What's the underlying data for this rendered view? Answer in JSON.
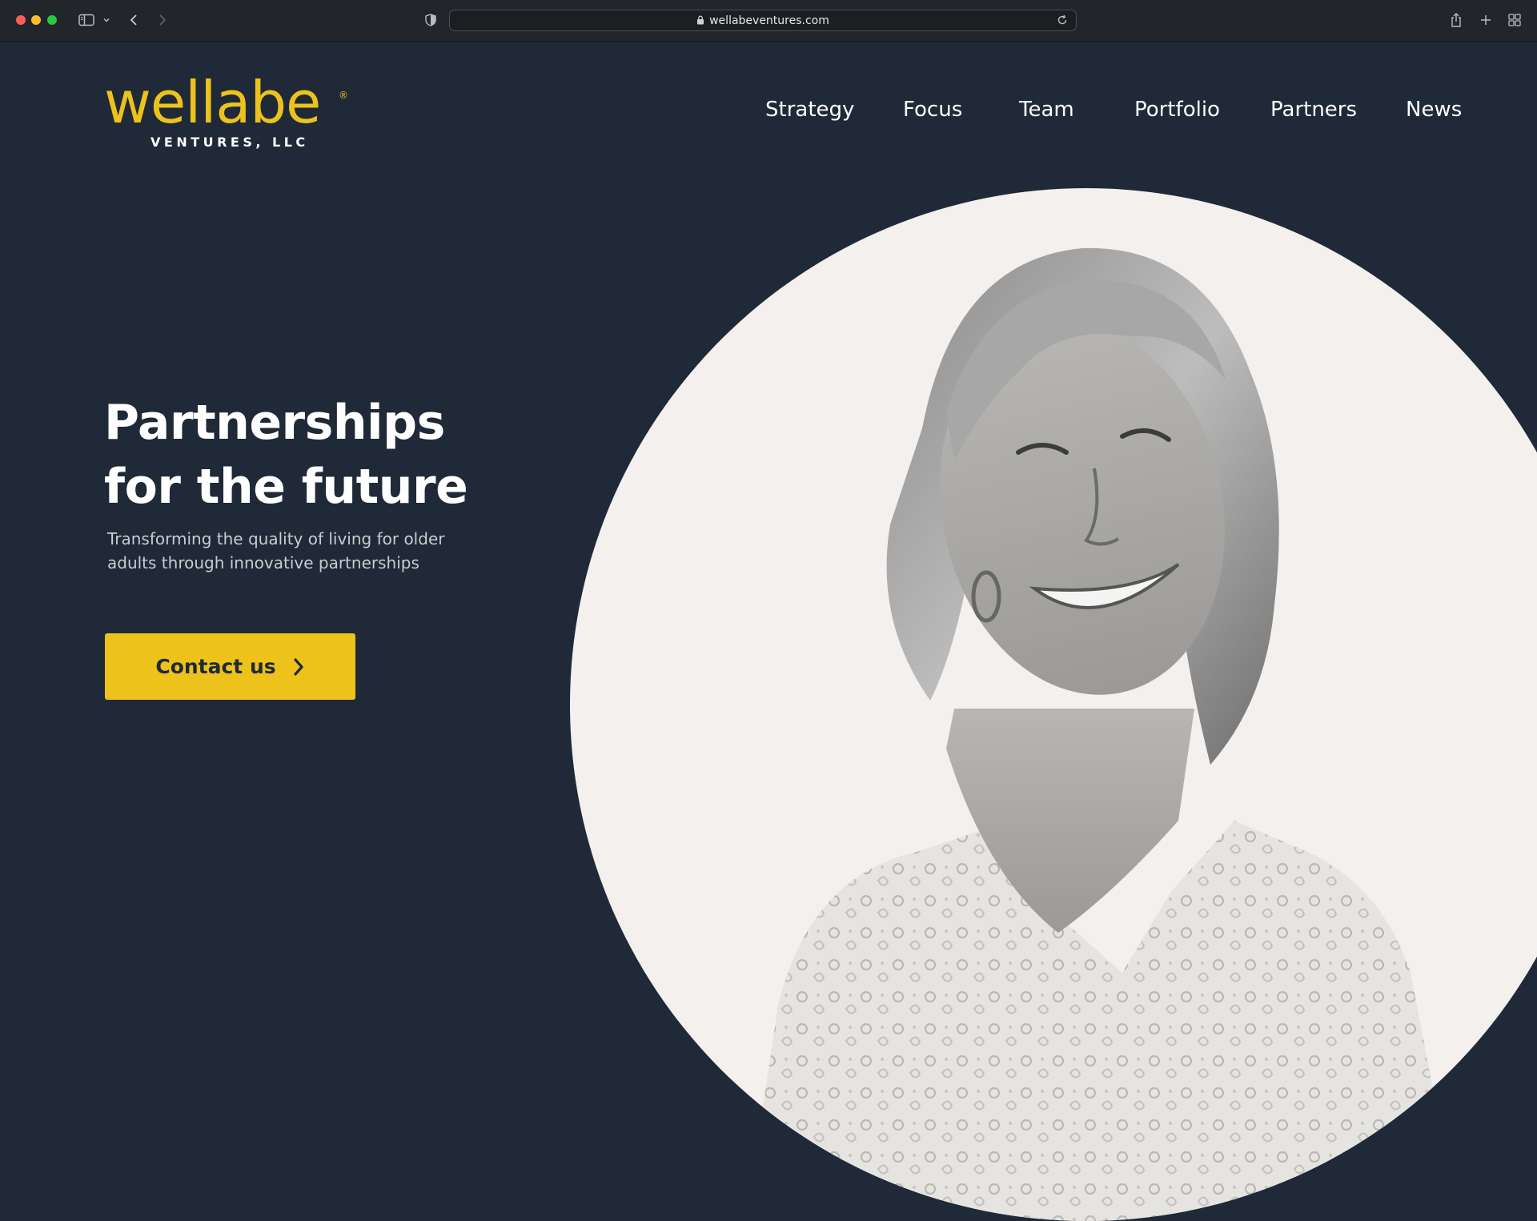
{
  "browser": {
    "url": "wellabeventures.com"
  },
  "logo": {
    "wordmark": "wellabe",
    "registered": "®",
    "subtitle": "VENTURES, LLC"
  },
  "nav": {
    "items": [
      {
        "label": "Strategy"
      },
      {
        "label": "Focus"
      },
      {
        "label": "Team"
      },
      {
        "label": "Portfolio"
      },
      {
        "label": "Partners"
      },
      {
        "label": "News"
      }
    ]
  },
  "hero": {
    "title_line1": "Partnerships",
    "title_line2": "for the future",
    "subtitle": "Transforming the quality of living for older adults through innovative partnerships",
    "cta_label": "Contact us"
  },
  "colors": {
    "page_background": "#1f2937",
    "brand_yellow": "#edc21a",
    "circle_background": "#f3f0ed",
    "text_white": "#ffffff"
  },
  "icons": {
    "cta_arrow": "chevron-right-icon",
    "sidebar": "sidebar-icon",
    "back": "back-arrow-icon",
    "forward": "forward-arrow-icon",
    "privacy": "shield-icon",
    "lock": "lock-icon",
    "reload": "reload-icon",
    "share": "share-icon",
    "new_tab": "plus-icon",
    "tab_overview": "tab-overview-icon"
  }
}
